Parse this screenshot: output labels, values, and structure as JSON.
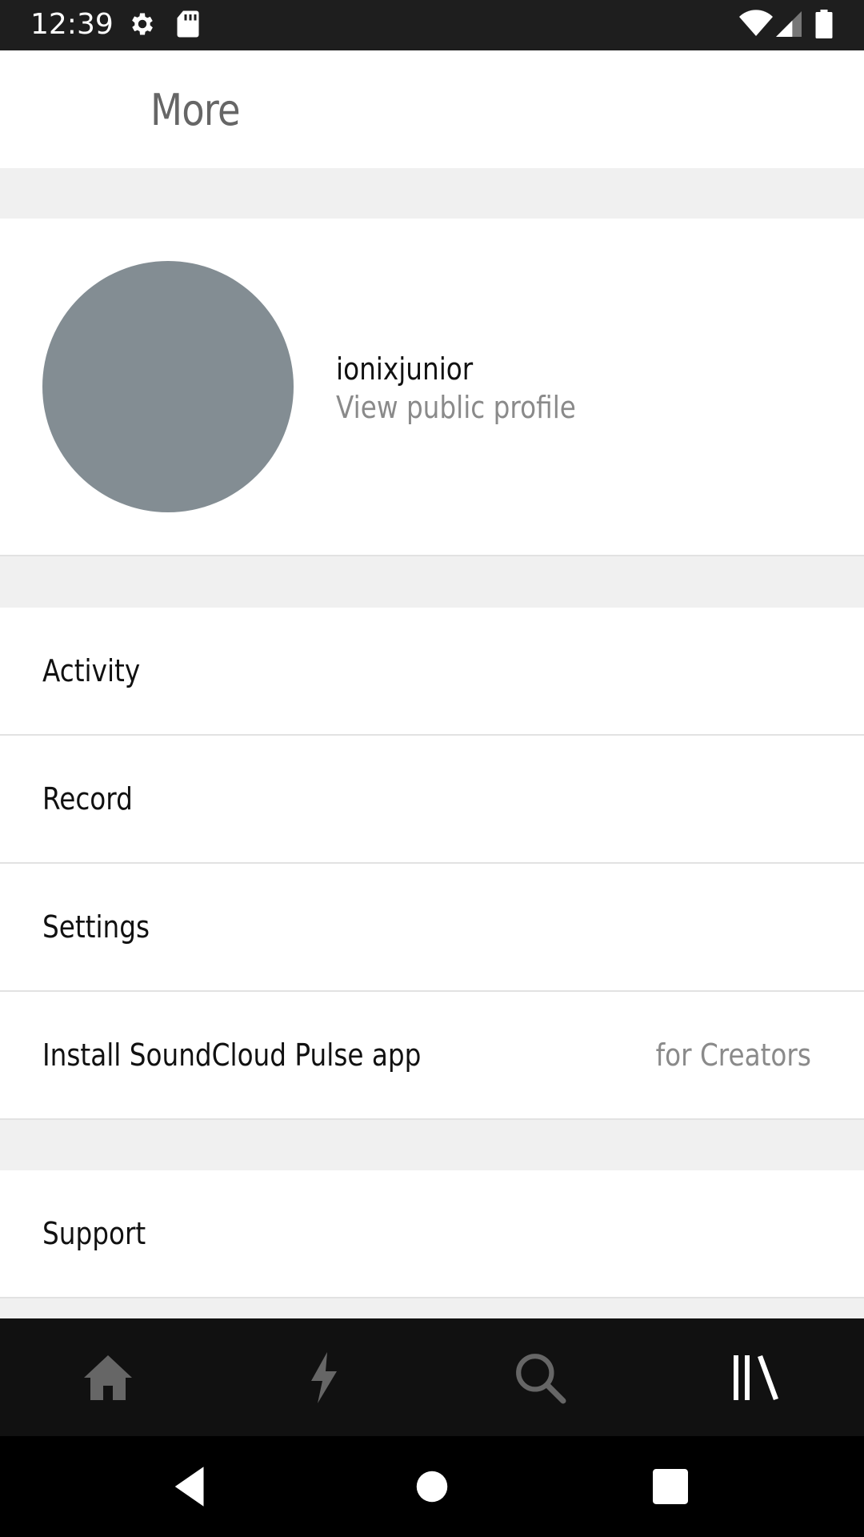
{
  "status_bar": {
    "time": "12:39",
    "icons": [
      "settings-icon",
      "sd-card-icon",
      "wifi-icon",
      "cell-signal-icon",
      "battery-icon"
    ]
  },
  "header": {
    "title": "More"
  },
  "profile": {
    "username": "ionixjunior",
    "link_label": "View public profile",
    "avatar_color": "#838d93"
  },
  "menu": {
    "activity": "Activity",
    "record": "Record",
    "settings": "Settings",
    "pulse": "Install SoundCloud Pulse app",
    "pulse_secondary": "for Creators",
    "support": "Support"
  },
  "bottom_nav": {
    "tabs": [
      "home-icon",
      "stream-icon",
      "search-icon",
      "library-icon"
    ],
    "active_tab": "library-icon",
    "active_color": "#ffffff",
    "inactive_color": "#666666"
  },
  "system_nav": {
    "buttons": [
      "back-icon",
      "home-circle-icon",
      "recents-icon"
    ]
  }
}
